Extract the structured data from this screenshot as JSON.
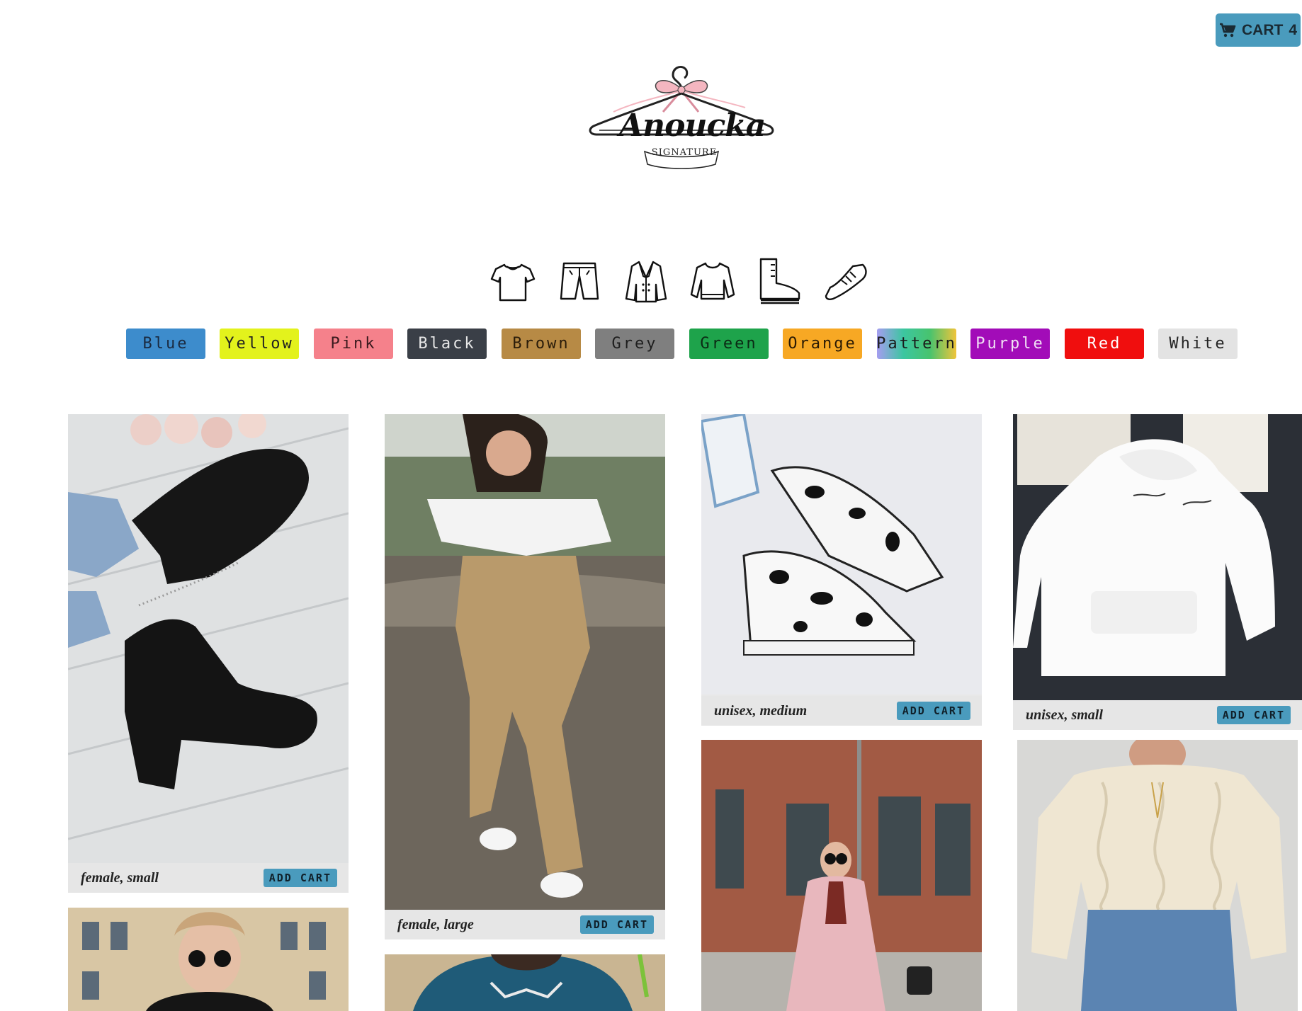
{
  "header": {
    "cart_label": "CART",
    "cart_count": "4",
    "logo_text": "Anoucka",
    "logo_subtext": "SIGNATURE"
  },
  "categories": [
    {
      "icon": "tshirt-icon"
    },
    {
      "icon": "shorts-icon"
    },
    {
      "icon": "jacket-icon"
    },
    {
      "icon": "sweater-icon"
    },
    {
      "icon": "boot-icon"
    },
    {
      "icon": "sneaker-icon"
    }
  ],
  "colors": [
    {
      "label": "Blue",
      "bg": "#3d8ccc",
      "fg": "#1a2a40"
    },
    {
      "label": "Yellow",
      "bg": "#e3f21c",
      "fg": "#222222"
    },
    {
      "label": "Pink",
      "bg": "#f5818b",
      "fg": "#3a1a1e"
    },
    {
      "label": "Black",
      "bg": "#3a3f47",
      "fg": "#e8e8e8"
    },
    {
      "label": "Brown",
      "bg": "#b78a45",
      "fg": "#2a1c0a"
    },
    {
      "label": "Grey",
      "bg": "#7f7f7f",
      "fg": "#1e1e1e"
    },
    {
      "label": "Green",
      "bg": "#1ea34b",
      "fg": "#0b2a14"
    },
    {
      "label": "Orange",
      "bg": "#f7a824",
      "fg": "#2a1a04"
    },
    {
      "label": "Pattern",
      "bg": "linear-gradient(90deg,#a59df0,#3cc6a0,#48c36e,#f0c43a)",
      "fg": "#1a1a1a"
    },
    {
      "label": "Purple",
      "bg": "#a20cb8",
      "fg": "#f0e0f4"
    },
    {
      "label": "Red",
      "bg": "#f00e0e",
      "fg": "#ffffff"
    },
    {
      "label": "White",
      "bg": "#e3e3e3",
      "fg": "#222222"
    }
  ],
  "products": [
    {
      "caption": "female, small",
      "button": "ADD CART",
      "image": "black-chelsea-boots-photo"
    },
    {
      "caption": "female, large",
      "button": "ADD CART",
      "image": "khaki-cargo-pants-photo"
    },
    {
      "caption": "unisex, medium",
      "button": "ADD CART",
      "image": "cow-print-sneakers-photo"
    },
    {
      "caption": "unisex, small",
      "button": "ADD CART",
      "image": "white-hoodie-photo"
    },
    {
      "image": "woman-sunglasses-street-photo"
    },
    {
      "image": "teal-sweatshirt-photo"
    },
    {
      "image": "pink-coat-street-photo"
    },
    {
      "image": "cream-knit-sweater-photo"
    }
  ]
}
